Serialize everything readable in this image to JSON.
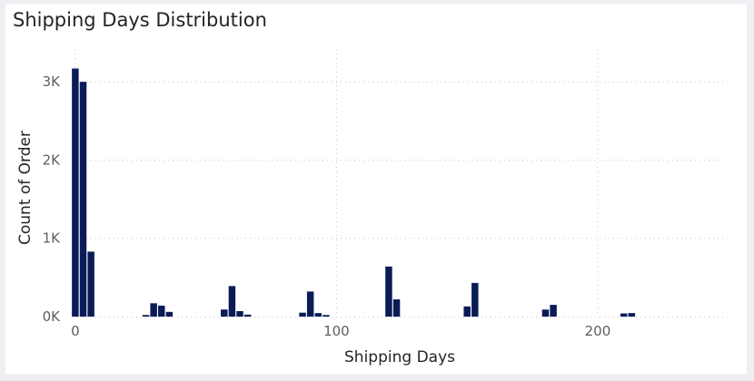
{
  "chart_data": {
    "type": "bar",
    "title": "Shipping Days Distribution",
    "xlabel": "Shipping Days",
    "ylabel": "Count of Order",
    "xlim": [
      -1,
      248
    ],
    "ylim": [
      0,
      3420
    ],
    "xticks": [
      0,
      100,
      200
    ],
    "xtick_labels": [
      "0",
      "100",
      "200"
    ],
    "yticks": [
      0,
      1000,
      2000,
      3000
    ],
    "ytick_labels": [
      "0K",
      "1K",
      "2K",
      "3K"
    ],
    "grid": true,
    "color": "#0b1b57",
    "x": [
      0,
      3,
      6,
      27,
      30,
      33,
      36,
      57,
      60,
      63,
      66,
      87,
      90,
      93,
      96,
      120,
      123,
      150,
      153,
      180,
      183,
      210,
      213
    ],
    "values": [
      3170,
      3000,
      830,
      20,
      170,
      140,
      60,
      90,
      390,
      70,
      25,
      50,
      320,
      45,
      20,
      640,
      220,
      130,
      430,
      90,
      150,
      40,
      45
    ]
  }
}
